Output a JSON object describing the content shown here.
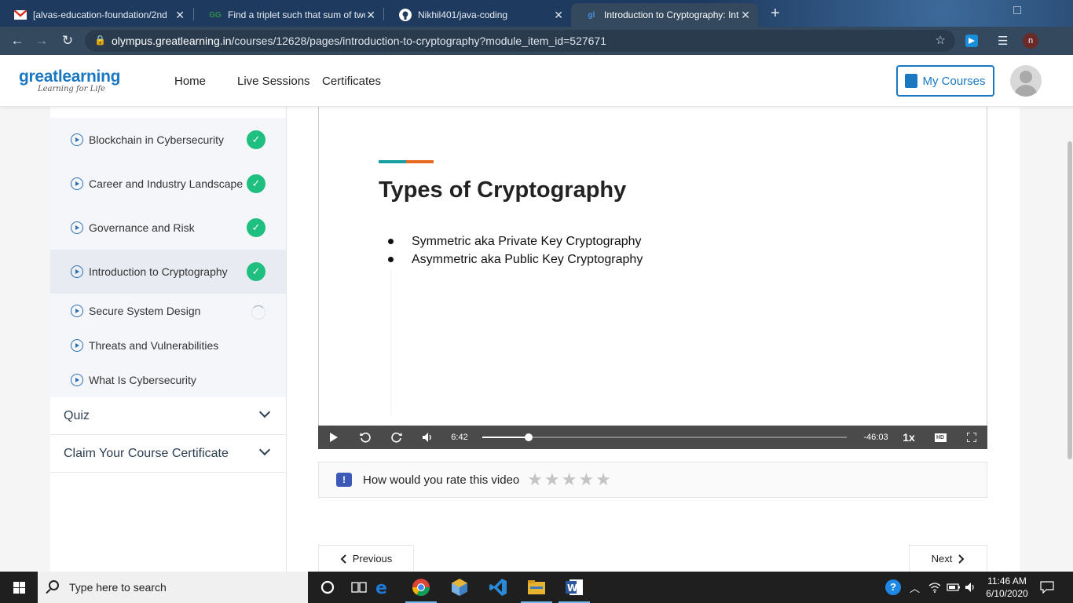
{
  "browser": {
    "tabs": [
      {
        "title": "[alvas-education-foundation/2nd",
        "favicon": "gmail-icon"
      },
      {
        "title": "Find a triplet such that sum of two",
        "favicon": "gfg-icon"
      },
      {
        "title": "Nikhil401/java-coding",
        "favicon": "github-icon"
      },
      {
        "title": "Introduction to Cryptography: Int",
        "favicon": "greatlearning-icon",
        "active": true
      }
    ],
    "url_host": "olympus.greatlearning.in",
    "url_path": "/courses/12628/pages/introduction-to-cryptography?module_item_id=527671",
    "profile_initial": "n"
  },
  "header": {
    "logo_main": "greatlearning",
    "logo_sub": "Learning for Life",
    "nav": [
      "Home",
      "Live Sessions",
      "Certificates"
    ],
    "my_courses": "My Courses"
  },
  "sidebar": {
    "items": [
      {
        "label": "Blockchain in Cybersecurity",
        "status": "complete"
      },
      {
        "label": "Career and Industry Landscape",
        "status": "complete"
      },
      {
        "label": "Governance and Risk",
        "status": "complete"
      },
      {
        "label": "Introduction to Cryptography",
        "status": "complete",
        "active": true
      },
      {
        "label": "Secure System Design",
        "status": "in-progress"
      },
      {
        "label": "Threats and Vulnerabilities",
        "status": "none"
      },
      {
        "label": "What Is Cybersecurity",
        "status": "none"
      }
    ],
    "sections": [
      {
        "label": "Quiz"
      },
      {
        "label": "Claim Your Course Certificate"
      }
    ]
  },
  "video": {
    "slide_title": "Types of Cryptography",
    "bullets": [
      "Symmetric aka Private Key Cryptography",
      "Asymmetric aka Public Key Cryptography"
    ],
    "current_time": "6:42",
    "remaining_time": "-46:03",
    "playback_speed": "1x",
    "progress_fraction": 0.127,
    "hd_label": "HD"
  },
  "rating": {
    "prompt": "How would you rate this video",
    "max_stars": 5,
    "selected_stars": 0
  },
  "pager": {
    "previous": "Previous",
    "next": "Next"
  },
  "taskbar": {
    "search_placeholder": "Type here to search",
    "time": "11:46 AM",
    "date": "6/10/2020"
  },
  "colors": {
    "brand_blue": "#1a78c2",
    "complete_green": "#1fbf7f",
    "slide_teal": "#199ea5",
    "slide_orange": "#e46a1f"
  }
}
